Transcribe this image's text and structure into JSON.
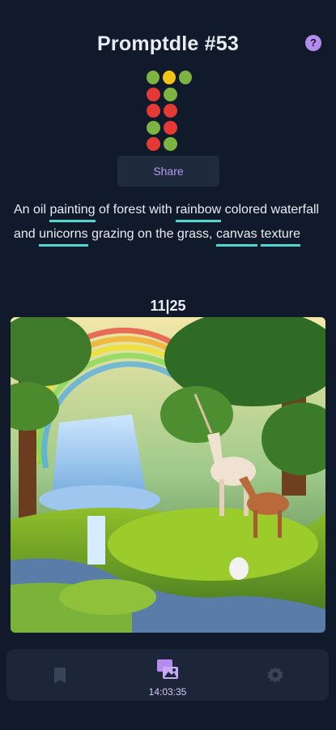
{
  "header": {
    "title": "Promptdle #53",
    "help_label": "?"
  },
  "colors": {
    "green": "#7cb342",
    "yellow": "#f2c31b",
    "red": "#e53935",
    "accent_purple": "#b48cf0",
    "keyword_underline": "#4fd8d0"
  },
  "guesses": [
    [
      "green",
      "yellow",
      "green"
    ],
    [
      "red",
      "green"
    ],
    [
      "red",
      "red"
    ],
    [
      "green",
      "red"
    ],
    [
      "red",
      "green"
    ]
  ],
  "share": {
    "label": "Share"
  },
  "prompt": {
    "segments": [
      {
        "text": "An oil ",
        "keyword": false
      },
      {
        "text": "painting",
        "keyword": true
      },
      {
        "text": " of forest with ",
        "keyword": false
      },
      {
        "text": "rainbow",
        "keyword": true
      },
      {
        "text": " colored waterfall and ",
        "keyword": false
      },
      {
        "text": "unicorns",
        "keyword": true
      },
      {
        "text": " grazing on the grass, ",
        "keyword": false
      },
      {
        "text": "canvas",
        "keyword": true
      },
      {
        "text": " ",
        "keyword": false
      },
      {
        "text": "texture",
        "keyword": true
      }
    ]
  },
  "score": {
    "text": "11|25"
  },
  "image": {
    "subject": "oil painting of forest with rainbow waterfall and unicorns"
  },
  "tabbar": {
    "items": [
      {
        "name": "bookmark",
        "icon": "bookmark-icon"
      },
      {
        "name": "image-prompt",
        "icon": "image-chat-icon"
      },
      {
        "name": "settings",
        "icon": "gear-icon"
      }
    ],
    "timer": "14:03:35"
  }
}
